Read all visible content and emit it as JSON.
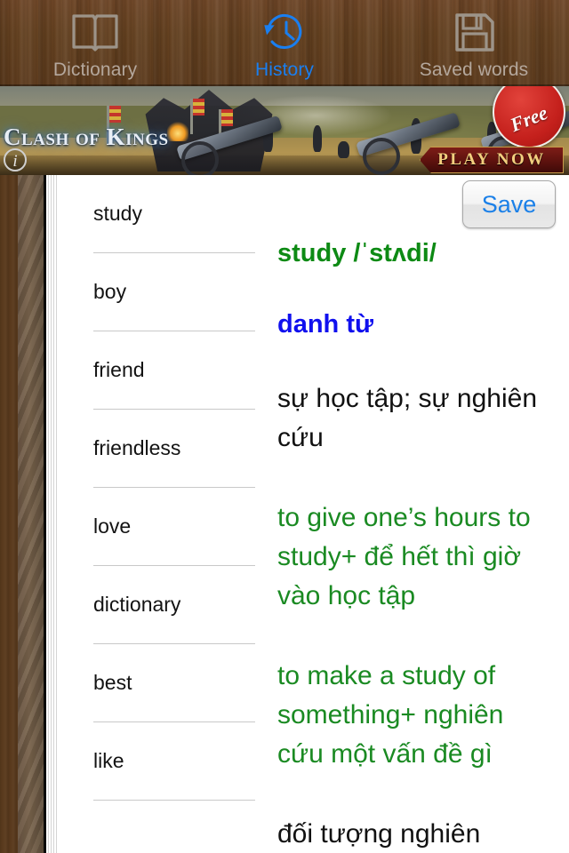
{
  "tabs": [
    {
      "label": "Dictionary",
      "icon": "book-icon",
      "active": false
    },
    {
      "label": "History",
      "icon": "clock-history-icon",
      "active": true
    },
    {
      "label": "Saved words",
      "icon": "floppy-disk-icon",
      "active": false
    }
  ],
  "ad": {
    "title": "Clash of Kings",
    "cta": "PLAY NOW",
    "badge": "Free",
    "info_icon": "info-icon"
  },
  "history": {
    "words": [
      "study",
      "boy",
      "friend",
      "friendless",
      "love",
      "dictionary",
      "best",
      "like"
    ]
  },
  "definition": {
    "save_label": "Save",
    "headword": "study /ˈstʌdi/",
    "part_of_speech": "danh từ",
    "sense": "sự học tập; sự nghiên cứu",
    "example_1": "to give one’s hours to study+ để hết thì giờ vào học tập",
    "example_2": "to make a study of something+ nghiên cứu một vấn đề gì",
    "sense_2_partial": "đối tượng nghiên"
  },
  "colors": {
    "green": "#0d8a14",
    "blue": "#1010ee",
    "tab_active": "#1a7ff0",
    "tab_inactive": "#b4a79c",
    "wood": "#5c3a1c",
    "save_text": "#1b80e8"
  }
}
